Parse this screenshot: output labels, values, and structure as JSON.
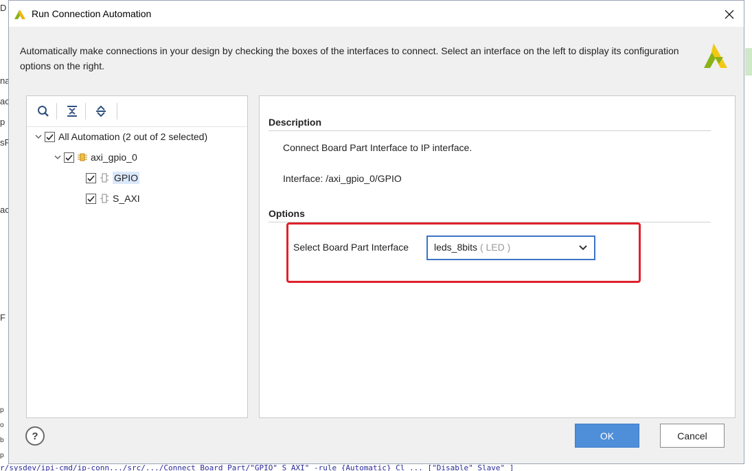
{
  "background": {
    "left_fragments": [
      "D",
      "na",
      "ac",
      "p",
      "sF",
      "ac",
      "F",
      "p",
      "o",
      "b",
      "p"
    ],
    "bottom_text": "    r/sysdev/ipi-cmd/ip-conn.../src/.../Connect Board Part/\"GPIO\" S_AXI\" -rule {Automatic} Cl ... [\"Disable\" Slave\" ]"
  },
  "dialog": {
    "title": "Run Connection Automation",
    "header_text": "Automatically make connections in your design by checking the boxes of the interfaces to connect. Select an interface on the left to display its configuration options on the right."
  },
  "tree": {
    "toolbar": [
      "search-icon",
      "collapse-all-icon",
      "expand-all-icon"
    ],
    "root": {
      "label": "All Automation (2 out of 2 selected)",
      "checked": true,
      "expanded": true
    },
    "ip": {
      "label": "axi_gpio_0",
      "checked": true,
      "expanded": true
    },
    "interfaces": [
      {
        "label": "GPIO",
        "checked": true,
        "selected": true
      },
      {
        "label": "S_AXI",
        "checked": true,
        "selected": false
      }
    ]
  },
  "details": {
    "description_title": "Description",
    "description_text": "Connect Board Part Interface to IP interface.",
    "interface_text": "Interface: /axi_gpio_0/GPIO",
    "options_title": "Options",
    "option_label": "Select Board Part Interface",
    "option_value": "leds_8bits",
    "option_value_suffix": "( LED )"
  },
  "footer": {
    "help_label": "?",
    "ok_label": "OK",
    "cancel_label": "Cancel"
  },
  "colors": {
    "accent": "#4f8ed8",
    "highlight_border": "#e0202b",
    "select_border": "#3b74c6",
    "selection_bg": "#dbe8fb"
  }
}
